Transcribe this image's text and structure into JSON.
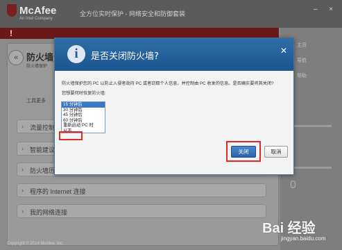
{
  "app": {
    "brand": "McAfee",
    "brand_sub": "An Intel Company",
    "title": "全方位实时保护 - 网络安全和防御套装",
    "window_controls": [
      "–",
      "×"
    ],
    "alert_icon": "!",
    "firewall_title": "防火墙",
    "firewall_sub": "防火墙保护",
    "tab_label": "工具更多",
    "sections": [
      "流量控制器",
      "智能建议和",
      "防火墙历史记录",
      "程序的 Internet 连接",
      "我的网络连接"
    ],
    "right_panel": [
      "主页",
      "导航",
      "帮助"
    ],
    "right_big": "0",
    "copyright": "Copyright © 2014 McAfee, Inc."
  },
  "dialog": {
    "title": "是否关闭防火墙?",
    "message": "防火墙保护您的 PC 以防止入侵者劫持 PC 或者窃取个人信息，并控制由 PC 收发的信息。是否确实要将其关闭?",
    "prompt": "您想要何时恢复防火墙:",
    "options": [
      "15 分钟后",
      "30 分钟后",
      "45 分钟后",
      "60 分钟后",
      "重新启动 PC 时",
      "从不"
    ],
    "selected_index": 0,
    "close_button": "关闭",
    "cancel_button": "取消"
  },
  "watermark": {
    "text": "Bai 经验",
    "url": "jingyan.baidu.com"
  },
  "colors": {
    "dialog_header": "#2f6ea8",
    "highlight": "#e32626",
    "alert": "#6b1818",
    "primary_button": "#3a77c4"
  }
}
